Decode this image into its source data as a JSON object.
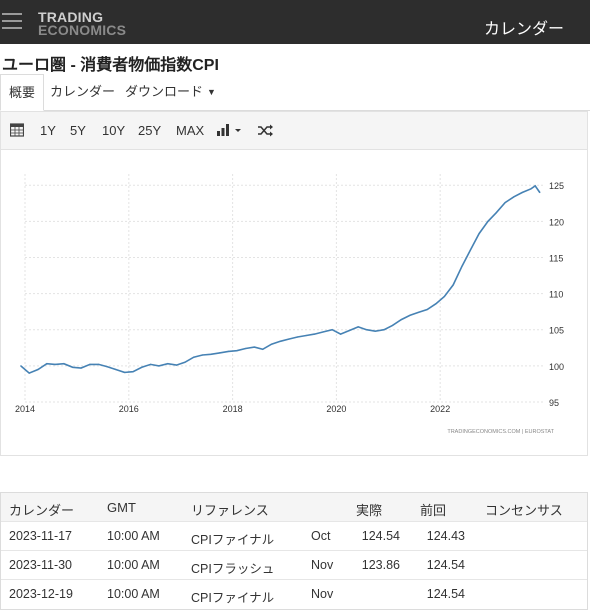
{
  "header": {
    "logo_line1": "TRADING",
    "logo_line2": "ECONOMICS",
    "nav_right": "カレンダー"
  },
  "page": {
    "title": "ユーロ圏 - 消費者物価指数CPI"
  },
  "tabs": [
    {
      "label": "概要"
    },
    {
      "label": "カレンダー"
    },
    {
      "label": "ダウンロード"
    }
  ],
  "toolbar": {
    "ranges": [
      "1Y",
      "5Y",
      "10Y",
      "25Y",
      "MAX"
    ]
  },
  "chart_data": {
    "type": "line",
    "title": "",
    "xlabel": "",
    "ylabel": "",
    "ylim": [
      95,
      126
    ],
    "xlim": [
      2014.0,
      2024.0
    ],
    "x_ticks": [
      "2014",
      "2016",
      "2018",
      "2020",
      "2022"
    ],
    "y_ticks": [
      "95",
      "100",
      "105",
      "110",
      "115",
      "120",
      "125"
    ],
    "grid": "dashed",
    "source": "TRADINGECONOMICS.COM | EUROSTAT",
    "color": "#4682b4",
    "series": [
      {
        "name": "",
        "points": [
          [
            2013.92,
            100.0
          ],
          [
            2014.08,
            99.0
          ],
          [
            2014.25,
            99.5
          ],
          [
            2014.42,
            100.3
          ],
          [
            2014.58,
            100.2
          ],
          [
            2014.75,
            100.3
          ],
          [
            2014.92,
            99.8
          ],
          [
            2015.08,
            99.7
          ],
          [
            2015.25,
            100.2
          ],
          [
            2015.42,
            100.2
          ],
          [
            2015.58,
            99.9
          ],
          [
            2015.75,
            99.5
          ],
          [
            2015.92,
            99.1
          ],
          [
            2016.08,
            99.2
          ],
          [
            2016.25,
            99.8
          ],
          [
            2016.42,
            100.2
          ],
          [
            2016.58,
            100.0
          ],
          [
            2016.75,
            100.3
          ],
          [
            2016.92,
            100.1
          ],
          [
            2017.08,
            100.5
          ],
          [
            2017.25,
            101.2
          ],
          [
            2017.42,
            101.5
          ],
          [
            2017.58,
            101.6
          ],
          [
            2017.75,
            101.8
          ],
          [
            2017.92,
            102.0
          ],
          [
            2018.08,
            102.1
          ],
          [
            2018.25,
            102.4
          ],
          [
            2018.42,
            102.6
          ],
          [
            2018.58,
            102.3
          ],
          [
            2018.75,
            103.0
          ],
          [
            2018.92,
            103.4
          ],
          [
            2019.08,
            103.7
          ],
          [
            2019.25,
            104.0
          ],
          [
            2019.42,
            104.2
          ],
          [
            2019.58,
            104.4
          ],
          [
            2019.75,
            104.7
          ],
          [
            2019.92,
            105.0
          ],
          [
            2020.08,
            104.4
          ],
          [
            2020.25,
            104.9
          ],
          [
            2020.42,
            105.4
          ],
          [
            2020.58,
            105.0
          ],
          [
            2020.75,
            104.8
          ],
          [
            2020.92,
            105.0
          ],
          [
            2021.08,
            105.6
          ],
          [
            2021.25,
            106.4
          ],
          [
            2021.42,
            107.0
          ],
          [
            2021.58,
            107.4
          ],
          [
            2021.75,
            107.8
          ],
          [
            2021.92,
            108.6
          ],
          [
            2022.08,
            109.6
          ],
          [
            2022.25,
            111.2
          ],
          [
            2022.42,
            113.8
          ],
          [
            2022.58,
            116.0
          ],
          [
            2022.75,
            118.3
          ],
          [
            2022.92,
            120.0
          ],
          [
            2023.08,
            121.2
          ],
          [
            2023.25,
            122.6
          ],
          [
            2023.42,
            123.4
          ],
          [
            2023.58,
            124.0
          ],
          [
            2023.75,
            124.5
          ],
          [
            2023.83,
            124.9
          ],
          [
            2023.92,
            124.0
          ]
        ]
      }
    ]
  },
  "calendar": {
    "headers": [
      "カレンダー",
      "GMT",
      "リファレンス",
      "実際",
      "前回",
      "コンセンサス"
    ],
    "rows": [
      {
        "date": "2023-11-17",
        "time": "10:00 AM",
        "ref": "CPIファイナル",
        "period": "Oct",
        "actual": "124.54",
        "previous": "124.43",
        "consensus": ""
      },
      {
        "date": "2023-11-30",
        "time": "10:00 AM",
        "ref": "CPIフラッシュ",
        "period": "Nov",
        "actual": "123.86",
        "previous": "124.54",
        "consensus": ""
      },
      {
        "date": "2023-12-19",
        "time": "10:00 AM",
        "ref": "CPIファイナル",
        "period": "Nov",
        "actual": "",
        "previous": "124.54",
        "consensus": ""
      }
    ]
  }
}
